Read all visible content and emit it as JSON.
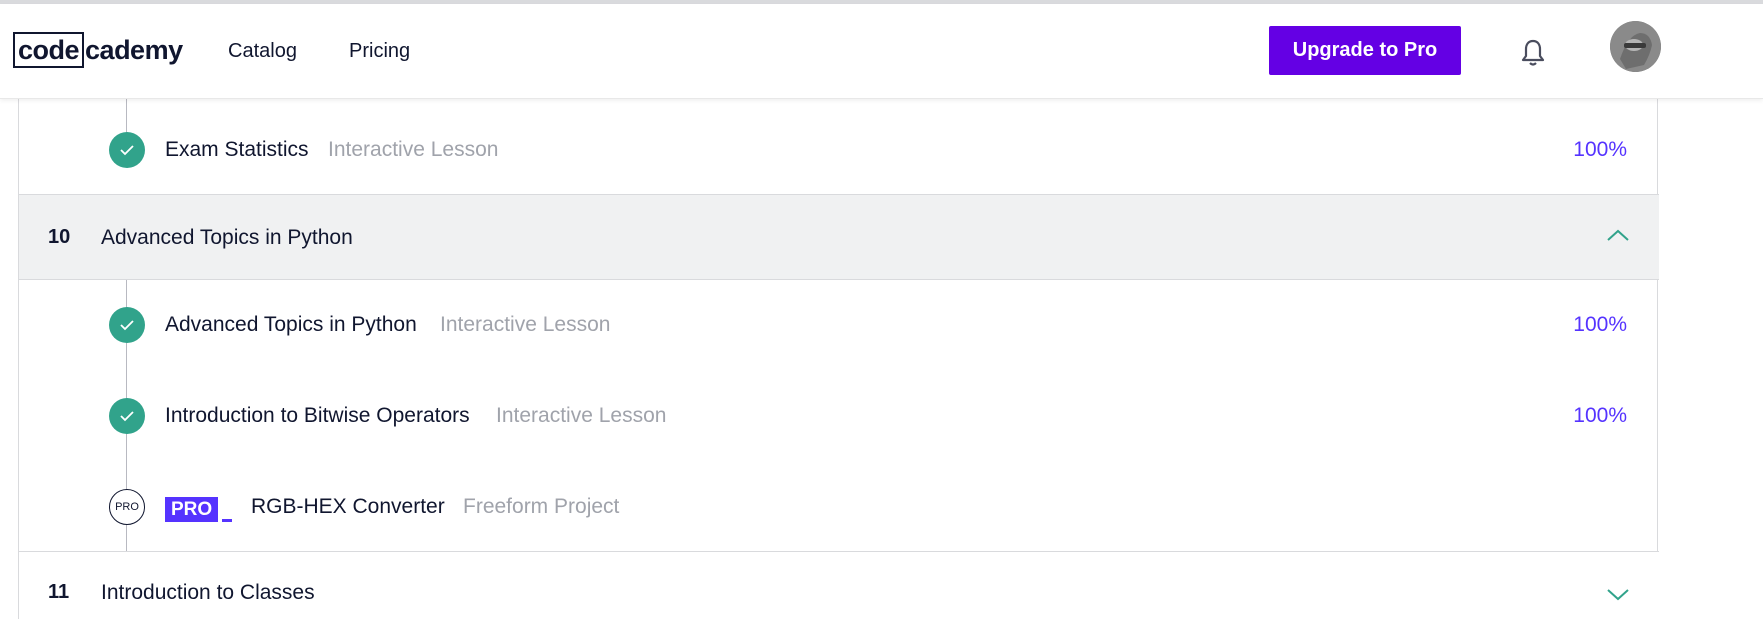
{
  "brand": {
    "logo_box": "code",
    "logo_rest": "cademy"
  },
  "nav": {
    "catalog": "Catalog",
    "pricing": "Pricing",
    "upgrade": "Upgrade to Pro"
  },
  "colors": {
    "accent": "#6400e4",
    "check": "#31a38b",
    "percent": "#5533ff",
    "muted": "#a0a3ab"
  },
  "syllabus": {
    "prev_lesson": {
      "title": "Exam Statistics",
      "type": "Interactive Lesson",
      "progress": "100%"
    },
    "module10": {
      "number": "10",
      "title": "Advanced Topics in Python",
      "expanded": true,
      "lessons": [
        {
          "title": "Advanced Topics in Python",
          "type": "Interactive Lesson",
          "progress": "100%",
          "status": "complete"
        },
        {
          "title": "Introduction to Bitwise Operators",
          "type": "Interactive Lesson",
          "progress": "100%",
          "status": "complete"
        },
        {
          "title": "RGB-HEX Converter",
          "type": "Freeform Project",
          "status": "pro",
          "badge": "PRO",
          "status_label": "PRO"
        }
      ]
    },
    "module11": {
      "number": "11",
      "title": "Introduction to Classes",
      "expanded": false
    }
  },
  "icons": {
    "bell": "bell-icon",
    "check": "check-icon",
    "chevron_up": "chevron-up-icon",
    "chevron_down": "chevron-down-icon"
  }
}
